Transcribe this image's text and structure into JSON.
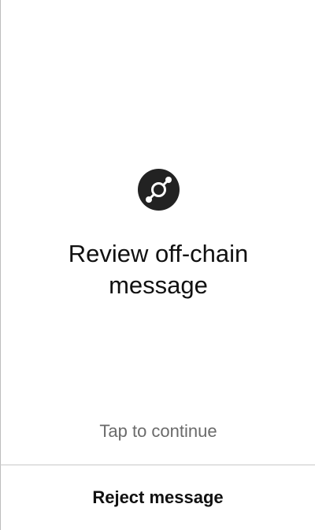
{
  "review": {
    "logo_icon": "helium-logo-icon",
    "title": "Review off-chain message",
    "tap_hint": "Tap to continue"
  },
  "footer": {
    "reject_label": "Reject message"
  },
  "colors": {
    "logo_fill": "#222222",
    "title": "#111111",
    "hint": "#6a6a6a",
    "divider": "#c8c8c8"
  }
}
